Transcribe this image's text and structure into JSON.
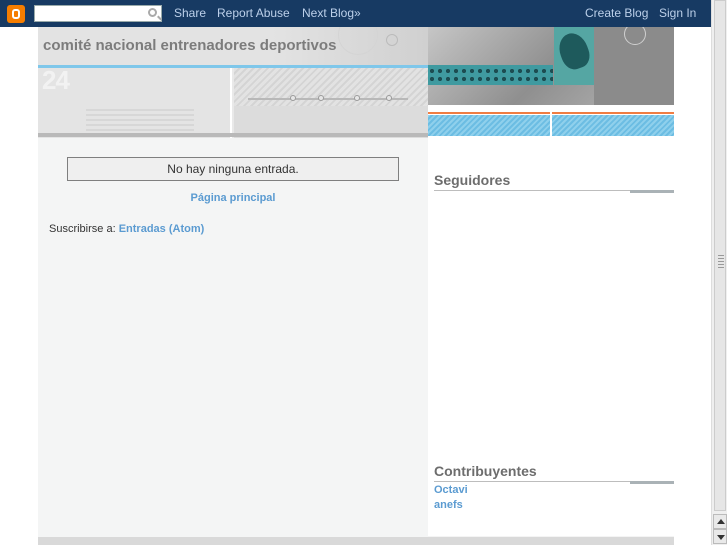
{
  "navbar": {
    "search_placeholder": "",
    "links": {
      "share": "Share",
      "report_abuse": "Report Abuse",
      "next_blog": "Next Blog»",
      "create_blog": "Create Blog",
      "sign_in": "Sign In"
    }
  },
  "header": {
    "title": "comité nacional entrenadores deportivos",
    "badge": "24"
  },
  "main": {
    "no_posts": "No hay ninguna entrada.",
    "home_link": "Página principal",
    "subscribe_label": "Suscribirse a:",
    "subscribe_link": "Entradas (Atom)"
  },
  "sidebar": {
    "followers_title": "Seguidores",
    "contributors_title": "Contribuyentes",
    "contributors": [
      "Octavi",
      "anefs"
    ]
  },
  "colors": {
    "navbar_bg": "#173a63",
    "link": "#5b9bd1",
    "blogger_orange": "#f57d00"
  }
}
